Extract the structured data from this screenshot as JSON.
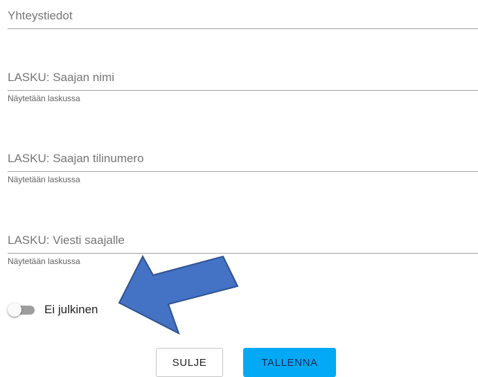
{
  "form": {
    "contact": {
      "placeholder": "Yhteystiedot",
      "value": ""
    },
    "invoice_recipient_name": {
      "placeholder": "LASKU: Saajan nimi",
      "value": "",
      "helper": "Näytetään laskussa"
    },
    "invoice_account_number": {
      "placeholder": "LASKU: Saajan tilinumero",
      "value": "",
      "helper": "Näytetään laskussa"
    },
    "invoice_message": {
      "placeholder": "LASKU: Viesti saajalle",
      "value": "",
      "helper": "Näytetään laskussa"
    },
    "public_toggle": {
      "label": "Ei julkinen",
      "checked": false
    }
  },
  "actions": {
    "close_label": "SULJE",
    "save_label": "TALLENNA"
  },
  "colors": {
    "primary": "#03a9f4",
    "annotation_arrow": "#4472c4",
    "annotation_arrow_border": "#2f528f"
  },
  "annotation": {
    "icon": "arrow-pointing-down-left-icon"
  }
}
